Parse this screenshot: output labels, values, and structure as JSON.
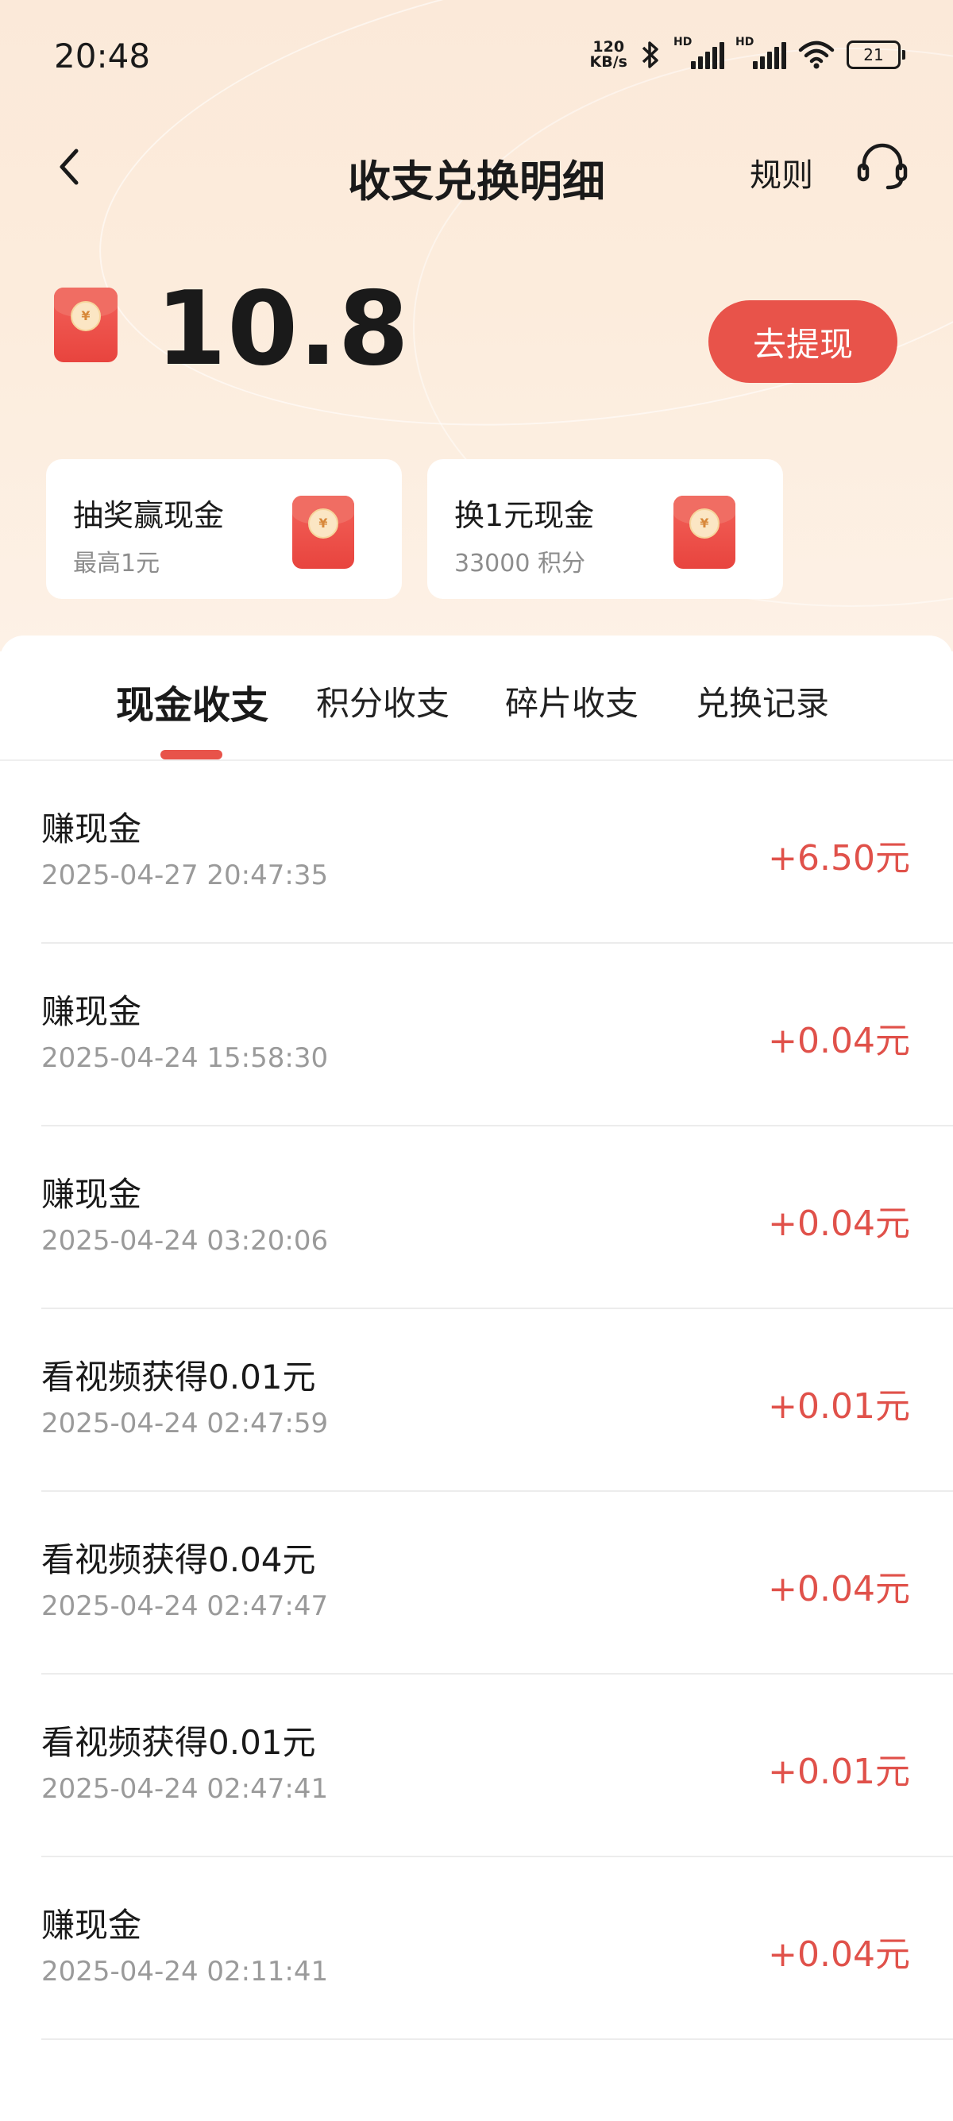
{
  "status_bar": {
    "time": "20:48",
    "net_speed_value": "120",
    "net_speed_unit": "KB/s",
    "hd1": "HD",
    "hd2": "HD",
    "battery": "21"
  },
  "header": {
    "title": "收支兑换明细",
    "rules_label": "规则"
  },
  "balance": {
    "amount": "10.8",
    "withdraw_label": "去提现"
  },
  "cards": [
    {
      "title": "抽奖赢现金",
      "subtitle": "最高1元"
    },
    {
      "title": "换1元现金",
      "subtitle": "33000 积分"
    }
  ],
  "tabs": [
    {
      "label": "现金收支",
      "active": true
    },
    {
      "label": "积分收支",
      "active": false
    },
    {
      "label": "碎片收支",
      "active": false
    },
    {
      "label": "兑换记录",
      "active": false
    }
  ],
  "records": [
    {
      "title": "赚现金",
      "time": "2025-04-27 20:47:35",
      "amount": "+6.50元"
    },
    {
      "title": "赚现金",
      "time": "2025-04-24 15:58:30",
      "amount": "+0.04元"
    },
    {
      "title": "赚现金",
      "time": "2025-04-24 03:20:06",
      "amount": "+0.04元"
    },
    {
      "title": "看视频获得0.01元",
      "time": "2025-04-24 02:47:59",
      "amount": "+0.01元"
    },
    {
      "title": "看视频获得0.04元",
      "time": "2025-04-24 02:47:47",
      "amount": "+0.04元"
    },
    {
      "title": "看视频获得0.01元",
      "time": "2025-04-24 02:47:41",
      "amount": "+0.01元"
    },
    {
      "title": "赚现金",
      "time": "2025-04-24 02:11:41",
      "amount": "+0.04元"
    }
  ],
  "icons": {
    "back": "chevron-left-icon",
    "service": "headset-icon",
    "envelope": "red-envelope-icon",
    "envelope_mark": "¥"
  },
  "colors": {
    "accent": "#e8534a",
    "amount": "#e0514a",
    "header_bg": "#fbe9d9"
  }
}
